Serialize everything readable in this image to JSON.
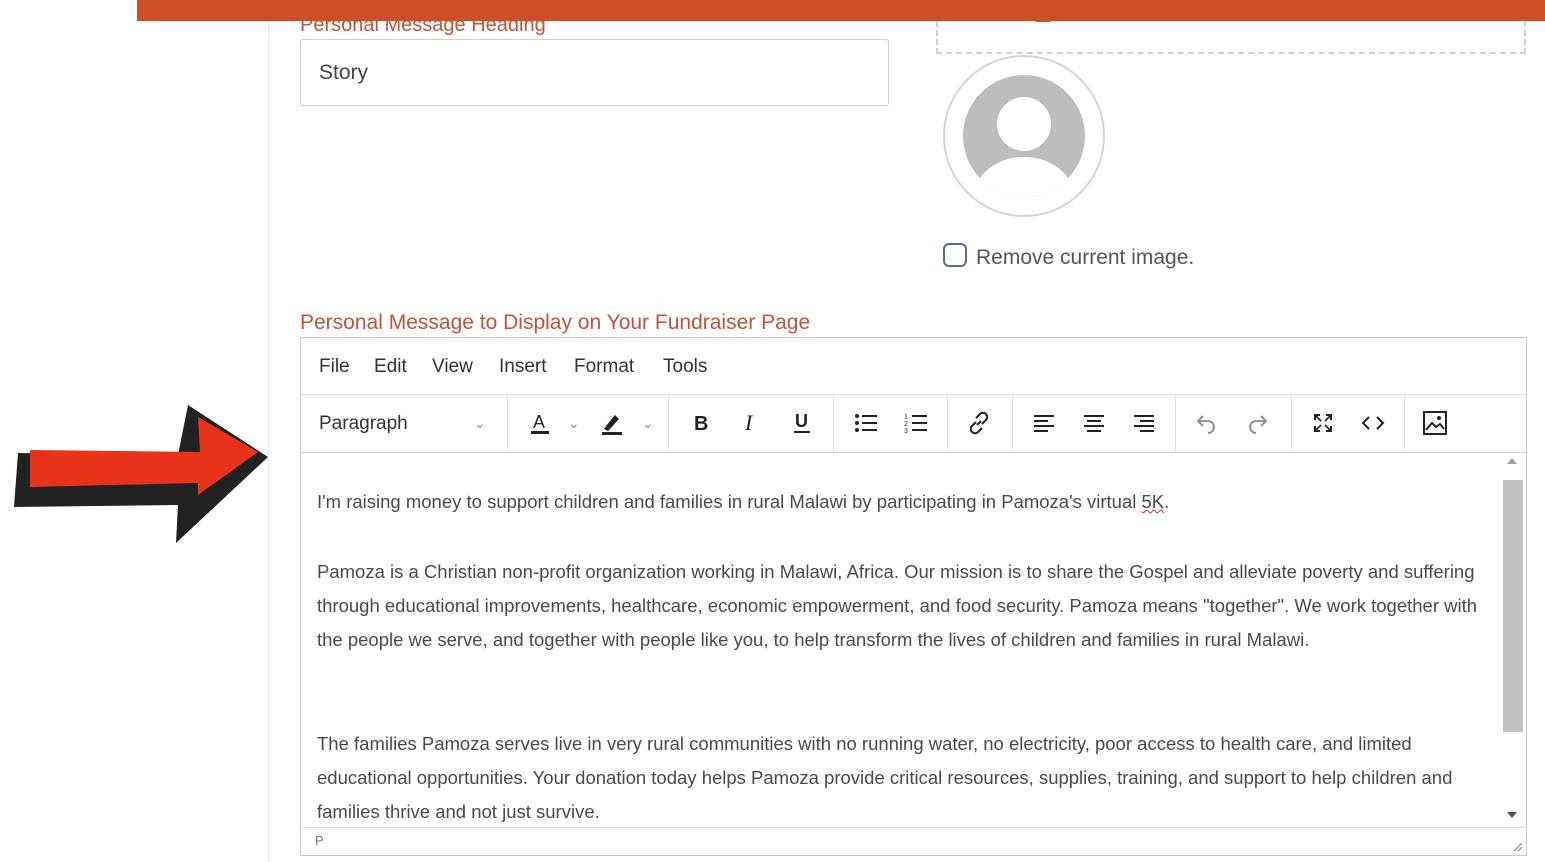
{
  "form": {
    "heading_label": "Personal Message Heading",
    "heading_value": "Story",
    "remove_image_label": "Remove current image.",
    "message_label": "Personal Message to Display on Your Fundraiser Page"
  },
  "editor": {
    "menu": [
      "File",
      "Edit",
      "View",
      "Insert",
      "Format",
      "Tools"
    ],
    "block_format": "Paragraph",
    "paragraphs": [
      {
        "before": "I'm raising money to support children and families in rural Malawi by participating in Pamoza's virtual ",
        "misspelled": "5K",
        "after": "."
      },
      {
        "text": "Pamoza is a Christian non-profit organization working in Malawi, Africa. Our mission is to share the Gospel and alleviate poverty and suffering through educational improvements, healthcare, economic empowerment, and food security. Pamoza means \"together\". We work together with the people we serve, and together with people like you, to help transform the lives of children and families in rural Malawi."
      },
      {
        "text": "The families Pamoza serves live in very rural communities with no running water, no electricity, poor access to health care, and limited educational opportunities. Your donation today helps Pamoza provide critical resources, supplies, training, and support to help children and families thrive and not just survive."
      }
    ],
    "status_path": "P"
  },
  "colors": {
    "banner": "#cc4f25",
    "label": "#c0533a",
    "arrow": "#e8321a",
    "checkbox_border": "#5a6b95"
  },
  "icons": [
    "text-color-icon",
    "highlight-icon",
    "bold-icon",
    "italic-icon",
    "underline-icon",
    "bullet-list-icon",
    "numbered-list-icon",
    "link-icon",
    "align-left-icon",
    "align-center-icon",
    "align-right-icon",
    "undo-icon",
    "redo-icon",
    "fullscreen-icon",
    "code-icon",
    "image-icon"
  ]
}
